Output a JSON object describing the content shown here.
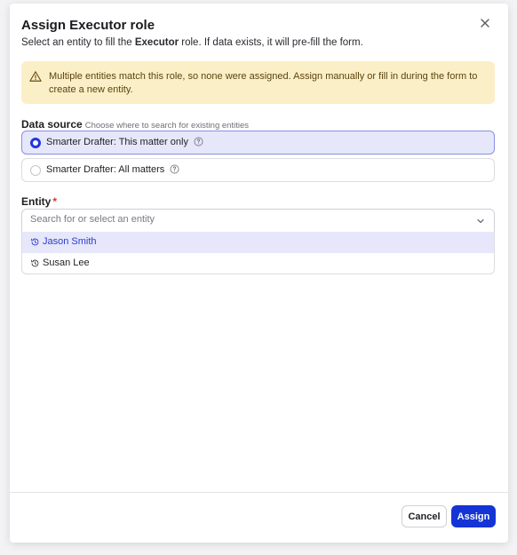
{
  "modal": {
    "title": "Assign Executor role",
    "subtitle_prefix": "Select an entity to fill the ",
    "subtitle_role": "Executor",
    "subtitle_suffix": " role. If data exists, it will pre-fill the form."
  },
  "warning": {
    "text": "Multiple entities match this role, so none were assigned. Assign manually or fill in during the form to create a new entity."
  },
  "data_source": {
    "label": "Data source",
    "hint": "Choose where to search for existing entities",
    "options": [
      {
        "label": "Smarter Drafter: This matter only",
        "selected": true
      },
      {
        "label": "Smarter Drafter: All matters",
        "selected": false
      }
    ]
  },
  "entity": {
    "label": "Entity",
    "required_mark": "*",
    "placeholder": "Search for or select an entity",
    "value": "",
    "options": [
      {
        "label": "Jason Smith",
        "highlighted": true
      },
      {
        "label": "Susan Lee",
        "highlighted": false
      }
    ]
  },
  "footer": {
    "cancel_label": "Cancel",
    "assign_label": "Assign"
  },
  "colors": {
    "accent": "#1434d6",
    "warning_bg": "#fbefc7",
    "selected_bg": "#e6e7fb"
  },
  "icons": {
    "close": "close-icon",
    "warning": "warning-triangle-icon",
    "help": "question-circle-icon",
    "chevron": "chevron-down-icon",
    "history": "history-icon"
  }
}
